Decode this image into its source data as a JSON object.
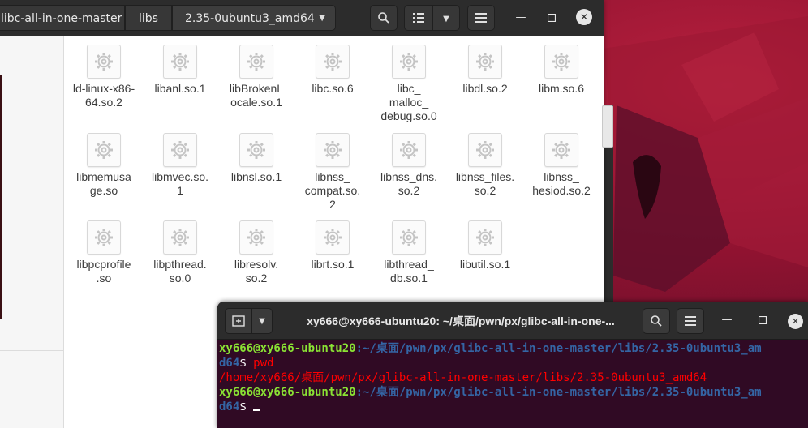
{
  "file_manager": {
    "breadcrumbs": [
      "libc-all-in-one-master",
      "libs",
      "2.35-0ubuntu3_amd64"
    ],
    "files": [
      "ld-linux-x86-\n64.so.2",
      "libanl.so.1",
      "libBrokenL\nocale.so.1",
      "libc.so.6",
      "libc_\nmalloc_\ndebug.so.0",
      "libdl.so.2",
      "libm.so.6",
      "libmemusa\nge.so",
      "libmvec.so.\n1",
      "libnsl.so.1",
      "libnss_\ncompat.so.\n2",
      "libnss_dns.\nso.2",
      "libnss_files.\nso.2",
      "libnss_\nhesiod.so.2",
      "libpcprofile\n.so",
      "libpthread.\nso.0",
      "libresolv.\nso.2",
      "librt.so.1",
      "libthread_\ndb.so.1",
      "libutil.so.1"
    ]
  },
  "terminal": {
    "title": "xy666@xy666-ubuntu20: ~/桌面/pwn/px/glibc-all-in-one-...",
    "prompt_user": "xy666@xy666-ubuntu20",
    "prompt_path_line1": ":~/桌面/pwn/px/glibc-all-in-one-master/libs/2.35-0ubuntu3_am",
    "prompt_path_line2": "d64",
    "prompt_symbol": "$ ",
    "command": "pwd",
    "output": "/home/xy666/桌面/pwn/px/glibc-all-in-one-master/libs/2.35-0ubuntu3_amd64"
  },
  "colors": {
    "terminal_bg": "#300a24",
    "prompt_user": "#8ae234",
    "prompt_path": "#3465a4",
    "output_text": "#ff0000",
    "headerbar": "#2c2c2c"
  }
}
